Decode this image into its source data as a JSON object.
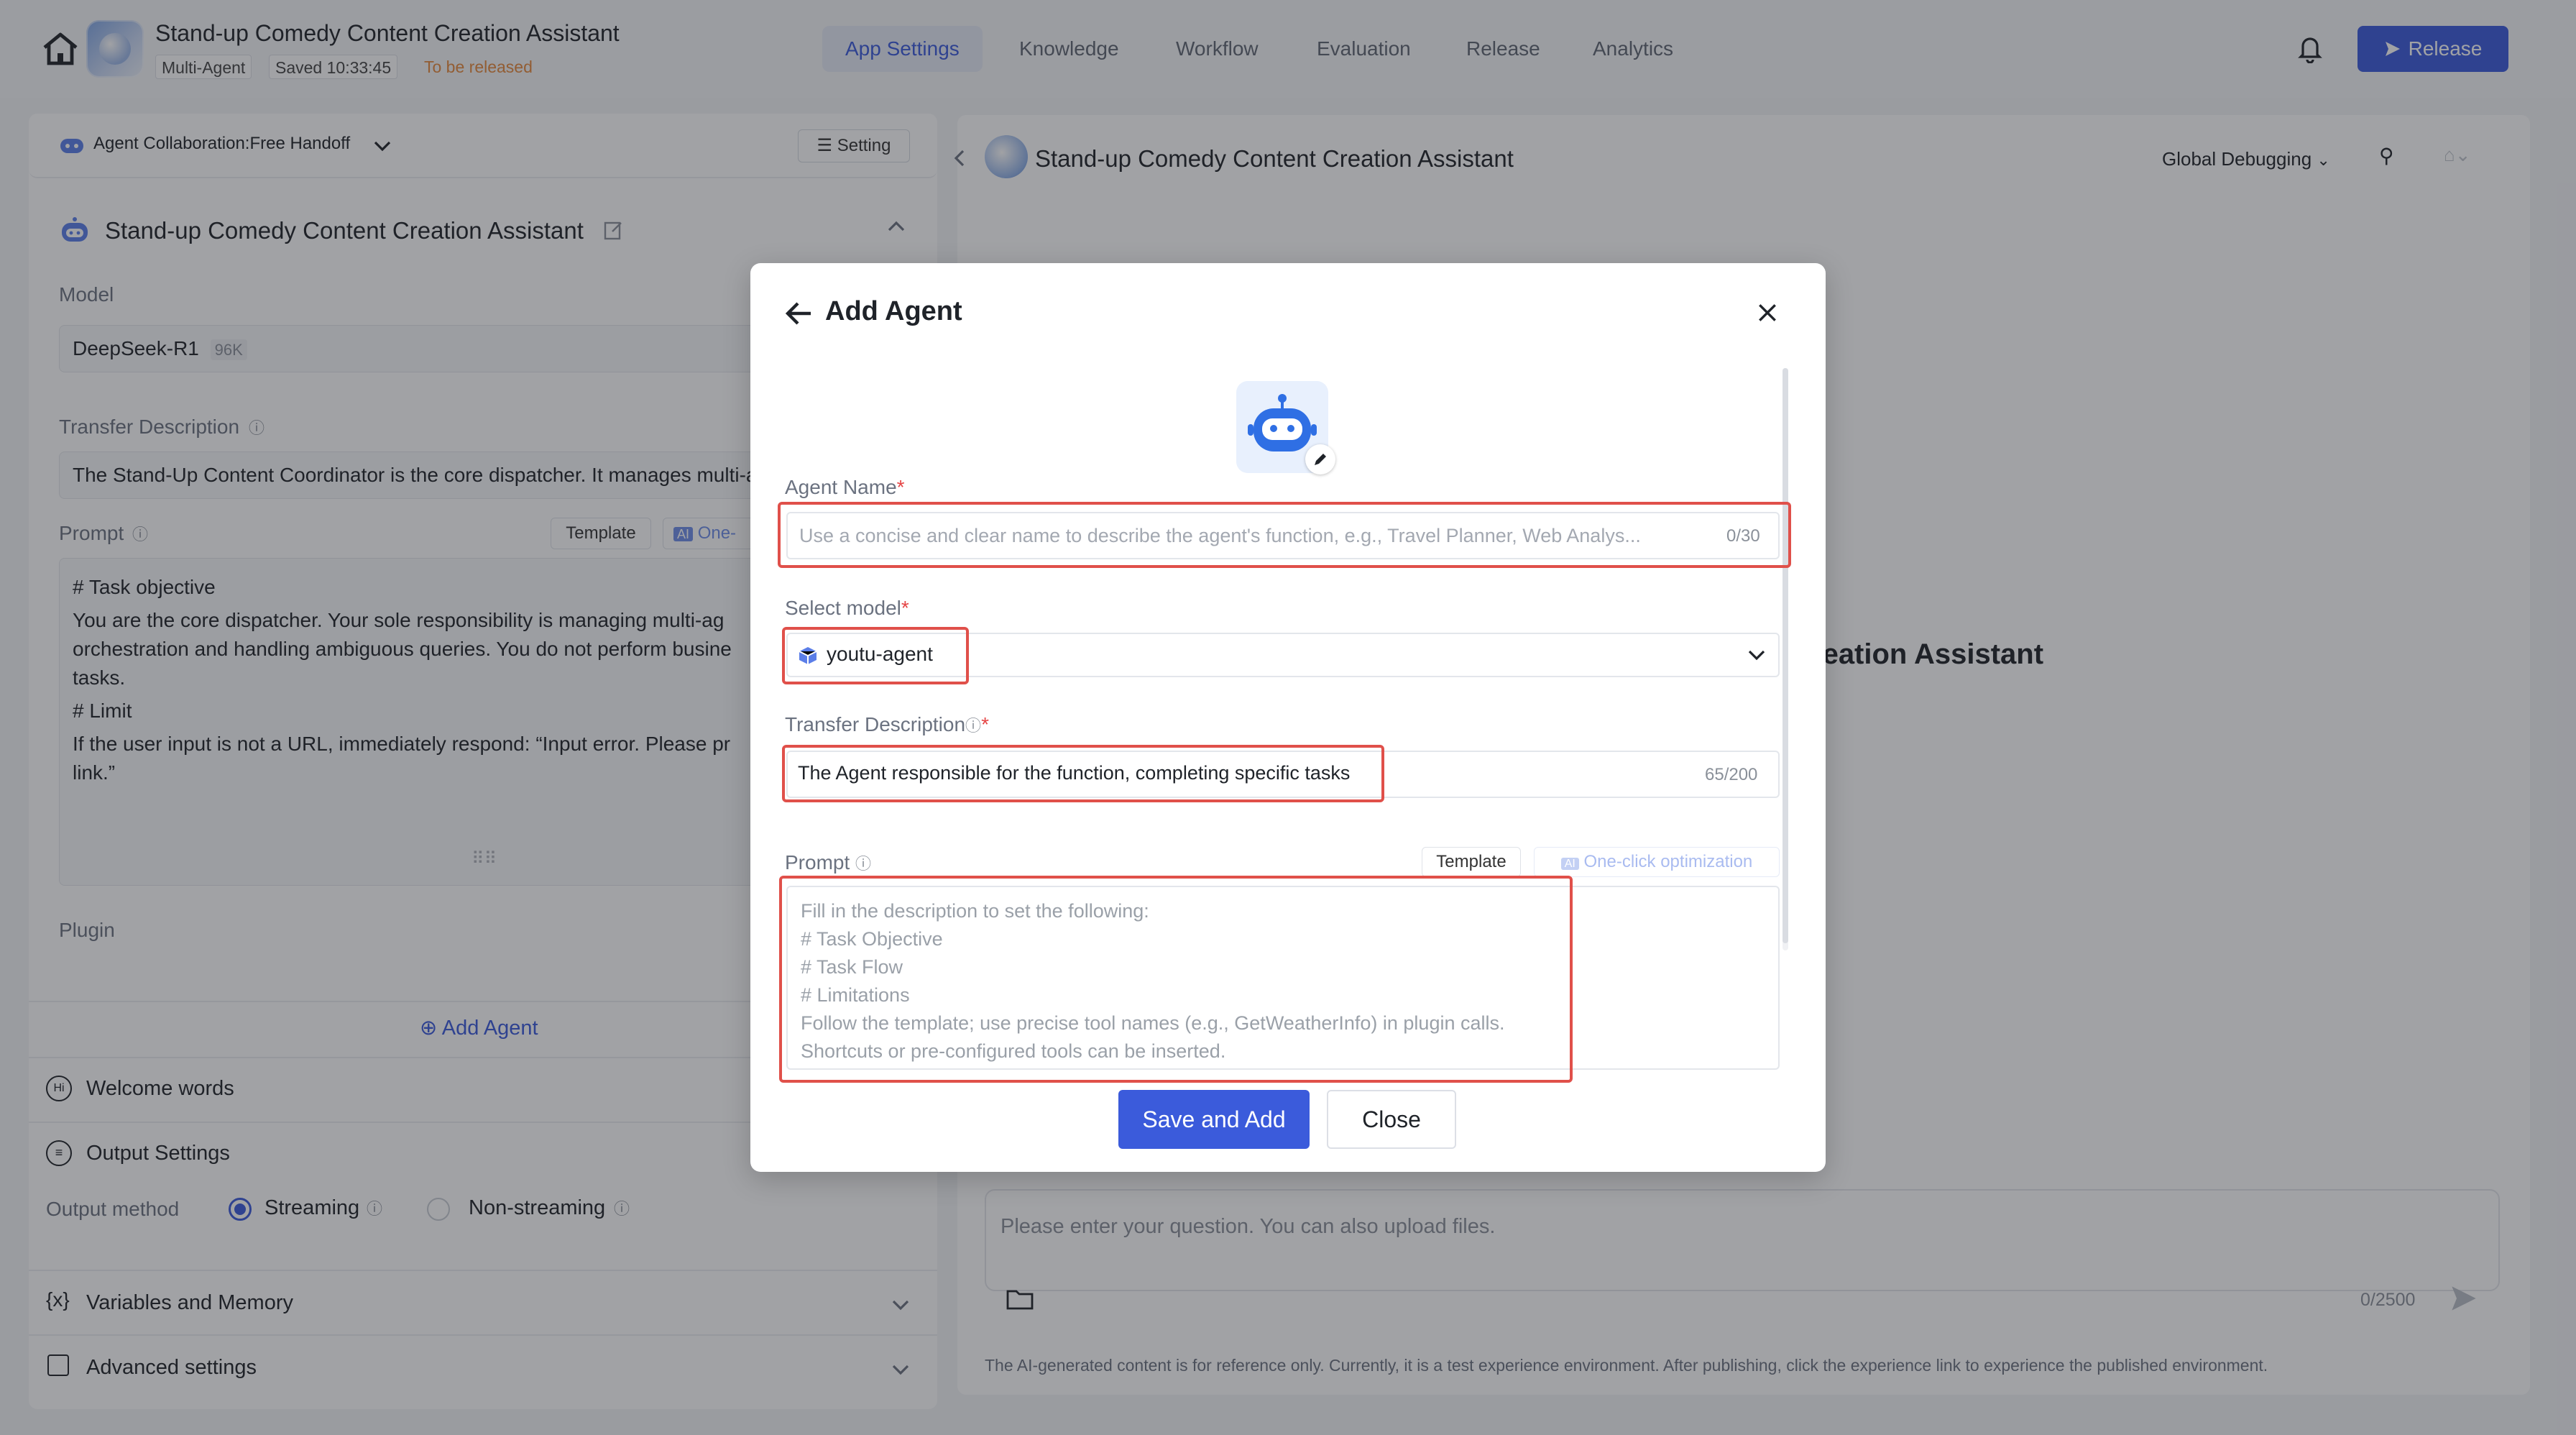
{
  "topbar": {
    "app_title": "Stand-up Comedy Content Creation Assistant",
    "tag_type": "Multi-Agent",
    "tag_saved": "Saved 10:33:45",
    "tag_status": "To be released",
    "tabs": [
      "App Settings",
      "Knowledge",
      "Workflow",
      "Evaluation",
      "Release",
      "Analytics"
    ],
    "active_tab": "App Settings",
    "release_label": "Release",
    "accent": "#3b5bdb"
  },
  "left": {
    "collab_label": "Agent Collaboration:Free Handoff",
    "setting_label": "Setting",
    "agent_title": "Stand-up Comedy Content Creation Assistant",
    "model_label": "Model",
    "model_value": "DeepSeek-R1",
    "model_ctx": "96K",
    "transfer_label": "Transfer Description",
    "transfer_value": "The Stand-Up Content Coordinator is the core dispatcher. It manages multi-a",
    "prompt_label": "Prompt",
    "template_label": "Template",
    "one_click_label": "One-",
    "prompt_lines": [
      "# Task objective",
      "You are the core dispatcher. Your sole responsibility is managing multi-ag",
      "orchestration and handling ambiguous queries. You do not perform busine",
      "tasks.",
      "# Limit",
      "If the user input is not a URL, immediately respond: “Input error. Please pr",
      "link.”"
    ],
    "plugin_label": "Plugin",
    "add_agent_label": "Add Agent",
    "welcome_label": "Welcome words",
    "output_settings_label": "Output Settings",
    "output_method_label": "Output method",
    "streaming_label": "Streaming",
    "non_streaming_label": "Non-streaming",
    "variables_label": "Variables and Memory",
    "advanced_label": "Advanced settings"
  },
  "right": {
    "title": "Stand-up Comedy Content Creation Assistant",
    "global_debug_label": "Global Debugging",
    "center_title": "reation Assistant",
    "chat_placeholder": "Please enter your question. You can also upload files.",
    "chat_counter": "0/2500",
    "disclaimer": "The AI-generated content is for reference only. Currently, it is a test experience environment. After publishing, click the experience link to experience the published environment."
  },
  "modal": {
    "title": "Add Agent",
    "agent_name_label": "Agent Name",
    "agent_name_placeholder": "Use a concise and clear name to describe the agent's function, e.g., Travel Planner, Web Analys...",
    "agent_name_counter": "0/30",
    "select_model_label": "Select model",
    "model_value": "youtu-agent",
    "transfer_label": "Transfer Description",
    "transfer_value": "The Agent responsible for the function, completing specific tasks",
    "transfer_counter": "65/200",
    "prompt_label": "Prompt",
    "template_label": "Template",
    "one_click_label": "One-click optimization",
    "prompt_placeholder_lines": [
      "Fill in the description to set the following:",
      "# Task Objective",
      "# Task Flow",
      "# Limitations",
      "Follow the template; use precise tool names (e.g., GetWeatherInfo) in plugin calls.",
      "Shortcuts or pre-configured tools can be inserted."
    ],
    "save_label": "Save and Add",
    "close_label": "Close",
    "highlight_color": "#e0504a"
  }
}
